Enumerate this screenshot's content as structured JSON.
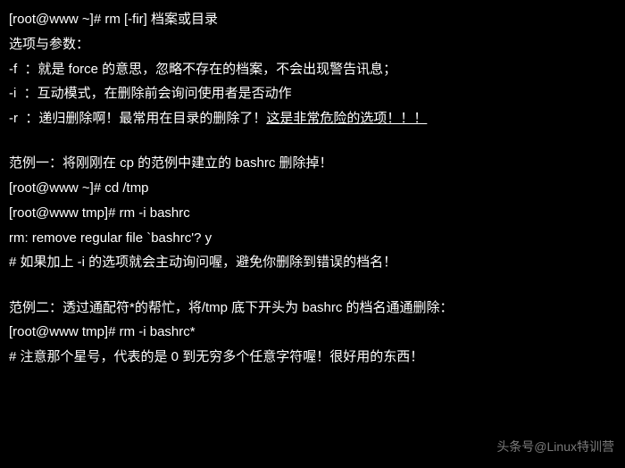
{
  "terminal": {
    "line1": "[root@www ~]# rm [-fir] 档案或目录",
    "line2": "选项与参数：",
    "line3": "-f  ：就是 force 的意思，忽略不存在的档案，不会出现警告讯息；",
    "line4": "-i  ：互动模式，在删除前会询问使用者是否动作",
    "line5_prefix": "-r  ：递归删除啊！最常用在目录的删除了！",
    "line5_underlined": "这是非常危险的选项！！！",
    "line6": "范例一：将刚刚在 cp 的范例中建立的 bashrc 删除掉！",
    "line7": "[root@www ~]# cd /tmp",
    "line8": "[root@www tmp]# rm -i bashrc",
    "line9": "rm: remove regular file `bashrc'? y",
    "line10": "# 如果加上 -i 的选项就会主动询问喔，避免你删除到错误的档名！",
    "line11": "范例二：透过通配符*的帮忙，将/tmp 底下开头为 bashrc 的档名通通删除：",
    "line12": "[root@www tmp]# rm -i bashrc*",
    "line13": "# 注意那个星号，代表的是 0 到无穷多个任意字符喔！很好用的东西！"
  },
  "watermark": "头条号@Linux特训营"
}
